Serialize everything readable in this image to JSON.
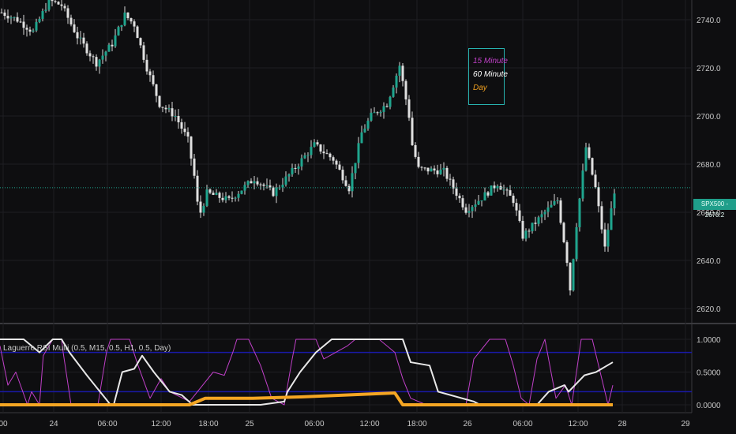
{
  "chart_data": [
    {
      "type": "candlestick",
      "symbol": "SPX500",
      "last_price": "2670.2",
      "ylim": [
        2615,
        2752
      ],
      "y_ticks": [
        "2740.0",
        "2720.0",
        "2700.0",
        "2680.0",
        "2660.0",
        "2640.0",
        "2620.0"
      ],
      "y_tick_values": [
        2740,
        2720,
        2700,
        2680,
        2660,
        2640,
        2620
      ],
      "x_ticks": [
        "00",
        "24",
        "06:00",
        "12:00",
        "18:00",
        "25",
        "06:00",
        "12:00",
        "18:00",
        "26",
        "06:00",
        "12:00",
        "28",
        "29"
      ],
      "x_tick_bars": [
        1,
        17,
        34,
        51,
        66,
        79,
        99.5,
        117,
        132,
        148,
        165.5,
        183,
        197,
        217
      ],
      "close_path": [
        [
          0,
          2743
        ],
        [
          5,
          2740
        ],
        [
          10,
          2735
        ],
        [
          15,
          2748
        ],
        [
          19,
          2746
        ],
        [
          24,
          2733
        ],
        [
          30,
          2722
        ],
        [
          35,
          2730
        ],
        [
          39,
          2742
        ],
        [
          42,
          2738
        ],
        [
          46,
          2720
        ],
        [
          50,
          2705
        ],
        [
          55,
          2700
        ],
        [
          59,
          2690
        ],
        [
          61,
          2675
        ],
        [
          62.5,
          2658
        ],
        [
          65,
          2668
        ],
        [
          72,
          2665
        ],
        [
          80,
          2674
        ],
        [
          86,
          2668
        ],
        [
          92,
          2677
        ],
        [
          99,
          2688
        ],
        [
          105,
          2682
        ],
        [
          110,
          2670
        ],
        [
          114,
          2693
        ],
        [
          117,
          2700
        ],
        [
          122,
          2705
        ],
        [
          126,
          2721
        ],
        [
          129,
          2700
        ],
        [
          130,
          2688
        ],
        [
          132,
          2678
        ],
        [
          140,
          2677
        ],
        [
          147,
          2661
        ],
        [
          152,
          2666
        ],
        [
          157,
          2672
        ],
        [
          162,
          2665
        ],
        [
          165,
          2650
        ],
        [
          172,
          2660
        ],
        [
          176,
          2665
        ],
        [
          179,
          2640
        ],
        [
          180,
          2628
        ],
        [
          182,
          2655
        ],
        [
          185,
          2687
        ],
        [
          188,
          2670
        ],
        [
          191,
          2645
        ],
        [
          194,
          2669
        ]
      ],
      "legend": [
        {
          "label": "15 Minute",
          "color": "#c040c8"
        },
        {
          "label": "60 Minute",
          "color": "#ffffff"
        },
        {
          "label": "Day",
          "color": "#f0a020"
        }
      ]
    },
    {
      "type": "line",
      "title": "Laguerre RSI Multi (0.5, M15, 0.5, H1, 0.5, Day)",
      "ylim": [
        0,
        1
      ],
      "y_ticks": [
        "1.0000",
        "0.5000",
        "0.0000"
      ],
      "y_tick_values": [
        1,
        0.5,
        0
      ],
      "levels": [
        0.8,
        0.2
      ],
      "series": [
        {
          "name": "15 Minute",
          "color": "#c040c8",
          "points": [
            [
              0,
              0.9
            ],
            [
              2.5,
              0.3
            ],
            [
              5,
              0.5
            ],
            [
              8.7,
              0
            ],
            [
              10,
              0.2
            ],
            [
              12.5,
              0
            ],
            [
              13.7,
              0.75
            ],
            [
              16.7,
              1
            ],
            [
              19.5,
              1
            ],
            [
              20,
              0.8
            ],
            [
              22.5,
              0
            ],
            [
              31,
              0
            ],
            [
              33.7,
              0.8
            ],
            [
              35,
              1
            ],
            [
              41,
              1
            ],
            [
              43.7,
              0.6
            ],
            [
              47.5,
              0.1
            ],
            [
              51,
              0.4
            ],
            [
              53.7,
              0.2
            ],
            [
              60,
              0.05
            ],
            [
              67.5,
              0.5
            ],
            [
              71,
              0.45
            ],
            [
              73.7,
              0.8
            ],
            [
              75,
              1
            ],
            [
              78.7,
              1
            ],
            [
              82.5,
              0.6
            ],
            [
              86,
              0.1
            ],
            [
              90,
              0
            ],
            [
              92.5,
              0.7
            ],
            [
              93.7,
              1
            ],
            [
              100,
              1
            ],
            [
              102.5,
              0.7
            ],
            [
              110,
              0.9
            ],
            [
              112.5,
              1
            ],
            [
              120,
              1
            ],
            [
              125,
              0.8
            ],
            [
              127.5,
              0.4
            ],
            [
              130,
              0.1
            ],
            [
              135,
              0
            ],
            [
              147.5,
              0
            ],
            [
              150,
              0.7
            ],
            [
              155,
              1
            ],
            [
              160,
              1
            ],
            [
              162.5,
              0.6
            ],
            [
              165,
              0.1
            ],
            [
              167.5,
              0
            ],
            [
              170,
              0.7
            ],
            [
              172.5,
              1
            ],
            [
              176,
              0.1
            ],
            [
              179,
              0.3
            ],
            [
              181,
              0
            ],
            [
              184,
              1
            ],
            [
              187.5,
              1
            ],
            [
              192.5,
              0
            ],
            [
              194,
              0.3
            ]
          ]
        },
        {
          "name": "60 Minute",
          "color": "#e8e8e8",
          "points": [
            [
              0,
              1
            ],
            [
              7.5,
              1
            ],
            [
              12.5,
              0.8
            ],
            [
              16.7,
              1
            ],
            [
              19.5,
              1
            ],
            [
              22,
              0.8
            ],
            [
              27.5,
              0.45
            ],
            [
              32.5,
              0.15
            ],
            [
              35,
              0
            ],
            [
              36,
              0
            ],
            [
              38.7,
              0.5
            ],
            [
              42.5,
              0.55
            ],
            [
              45,
              0.75
            ],
            [
              48.7,
              0.5
            ],
            [
              53.7,
              0.2
            ],
            [
              57.5,
              0.15
            ],
            [
              61,
              0
            ],
            [
              82.5,
              0
            ],
            [
              90,
              0.05
            ],
            [
              91,
              0.2
            ],
            [
              95,
              0.5
            ],
            [
              100,
              0.8
            ],
            [
              105,
              1
            ],
            [
              127.5,
              1
            ],
            [
              130,
              0.65
            ],
            [
              136,
              0.6
            ],
            [
              138.7,
              0.2
            ],
            [
              150,
              0.05
            ],
            [
              152,
              0
            ],
            [
              170,
              0
            ],
            [
              173.7,
              0.2
            ],
            [
              178.7,
              0.3
            ],
            [
              180,
              0.2
            ],
            [
              185,
              0.45
            ],
            [
              188.7,
              0.5
            ],
            [
              194,
              0.65
            ]
          ]
        },
        {
          "name": "Day",
          "color": "#f5a623",
          "points": [
            [
              0,
              0
            ],
            [
              60,
              0
            ],
            [
              65,
              0.1
            ],
            [
              80,
              0.1
            ],
            [
              95,
              0.12
            ],
            [
              125,
              0.18
            ],
            [
              127.5,
              0
            ],
            [
              194,
              0
            ]
          ]
        }
      ]
    }
  ]
}
